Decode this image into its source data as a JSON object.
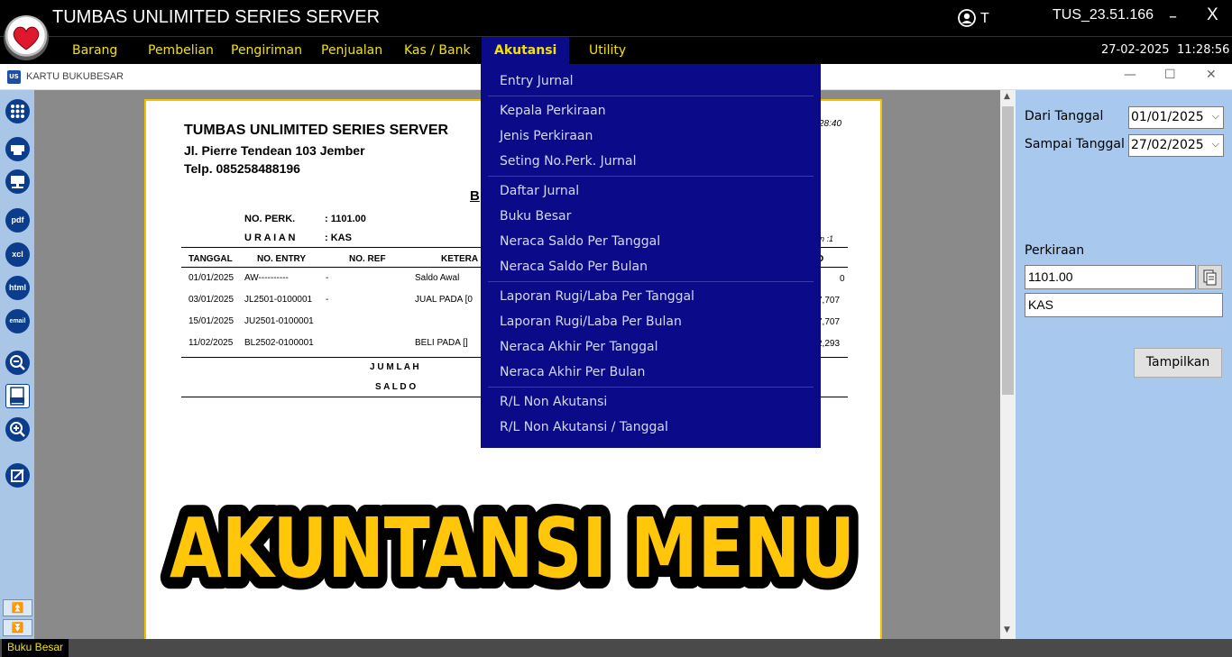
{
  "titlebar": {
    "app_title": "TUMBAS UNLIMITED SERIES SERVER",
    "user": "T",
    "server_id": "TUS_23.51.166",
    "minimize": "–",
    "close": "X"
  },
  "menubar": {
    "items": [
      "Barang",
      "Pembelian",
      "Pengiriman",
      "Penjualan",
      "Kas / Bank",
      "Akutansi",
      "Utility"
    ],
    "active": "Akutansi",
    "date": "27-02-2025",
    "time": "11:28:56"
  },
  "child_window": {
    "icon": "US",
    "title": "KARTU BUKUBESAR"
  },
  "toolbar": {
    "buttons": [
      "grid-icon",
      "printer-icon",
      "print-setup-icon",
      "pdf",
      "xcl",
      "html",
      "email",
      "zoom-out-icon",
      "zoom-100-icon",
      "zoom-in-icon",
      "edit-icon"
    ],
    "labels": {
      "pdf": "pdf",
      "xcl": "xcl",
      "html": "html",
      "email": "email"
    }
  },
  "report": {
    "company": "TUMBAS UNLIMITED SERIES SERVER",
    "address": "Jl. Pierre Tendean 103 Jember",
    "phone": "Telp. 085258488196",
    "time_fragment": "28:40",
    "title_fragment": "B",
    "no_perk_label": "NO. PERK.",
    "no_perk_value": ": 1101.00",
    "uraian_label": "U R A I A N",
    "uraian_value": ": KAS",
    "page_fragment": "an :1",
    "columns": [
      "TANGGAL",
      "NO. ENTRY",
      "NO. REF",
      "KETERA",
      "D"
    ],
    "rows": [
      {
        "tanggal": "01/01/2025",
        "entry": "AW----------",
        "ref": "-",
        "ket": "Saldo Awal",
        "saldo": "0"
      },
      {
        "tanggal": "03/01/2025",
        "entry": "JL2501-0100001",
        "ref": "-",
        "ket": "JUAL PADA [0",
        "saldo": "7,707"
      },
      {
        "tanggal": "15/01/2025",
        "entry": "JU2501-0100001",
        "ref": "",
        "ket": "",
        "saldo": "7,707"
      },
      {
        "tanggal": "11/02/2025",
        "entry": "BL2502-0100001",
        "ref": "",
        "ket": "BELI PADA []",
        "saldo": "2,293"
      }
    ],
    "jumlah": "J U M L A H",
    "saldo": "S A L D O"
  },
  "filter": {
    "dari_label": "Dari Tanggal",
    "dari_value": "01/01/2025",
    "sampai_label": "Sampai Tanggal",
    "sampai_value": "27/02/2025",
    "perkiraan_label": "Perkiraan",
    "perkiraan_code": "1101.00",
    "perkiraan_name": "KAS",
    "button": "Tampilkan"
  },
  "dropdown": {
    "groups": [
      [
        "Entry Jurnal"
      ],
      [
        "Kepala Perkiraan",
        "Jenis Perkiraan",
        "Seting No.Perk. Jurnal"
      ],
      [
        "Daftar Jurnal",
        "Buku Besar",
        "Neraca Saldo Per Tanggal",
        "Neraca Saldo Per Bulan"
      ],
      [
        "Laporan Rugi/Laba Per Tanggal",
        "Laporan Rugi/Laba Per Bulan",
        "Neraca Akhir Per Tanggal",
        "Neraca Akhir Per Bulan"
      ],
      [
        "R/L Non Akutansi",
        "R/L Non Akutansi / Tanggal"
      ]
    ]
  },
  "banner": {
    "text": "AKUNTANSI MENU"
  },
  "status": {
    "text": "Buku Besar"
  }
}
